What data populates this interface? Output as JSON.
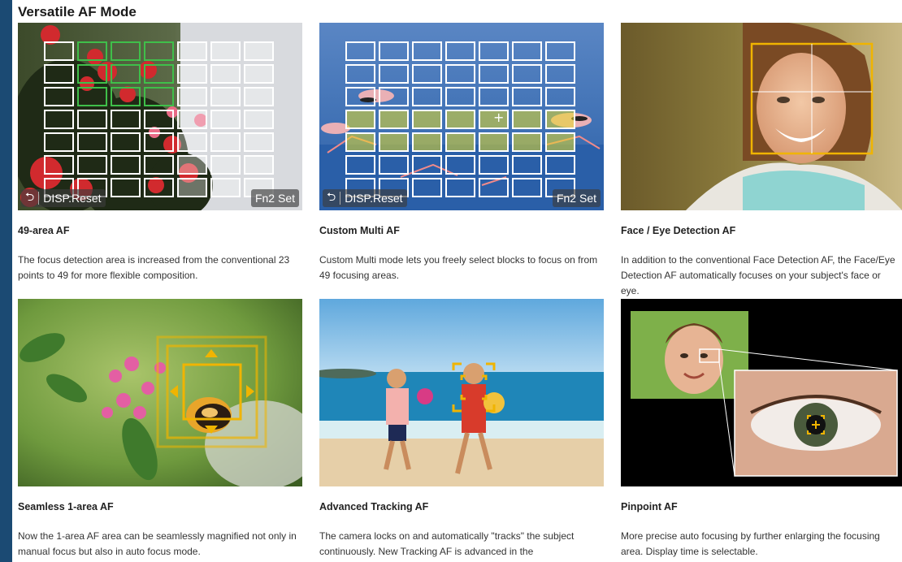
{
  "page": {
    "title": "Versatile AF Mode"
  },
  "colors": {
    "left_bar": "#1b4a73",
    "grid_line": "#ffffff",
    "grid_active": "#3fbf4a",
    "af_frame": "#f0b400"
  },
  "cards": [
    {
      "title": "49-area AF",
      "desc": "The focus detection area is increased from the conventional 23 points to 49 for more flexible composition.",
      "image": "flower-af-grid",
      "overlay": {
        "back_icon": "return-arrow-icon",
        "left_label": "DISP.Reset",
        "right_label": "Fn2 Set"
      }
    },
    {
      "title": "Custom Multi AF",
      "desc": "Custom Multi mode lets you freely select blocks to focus on from 49 focusing areas.",
      "image": "flamingo-af-grid",
      "overlay": {
        "back_icon": "return-arrow-icon",
        "left_label": "DISP.Reset",
        "right_label": "Fn2 Set"
      }
    },
    {
      "title": "Face / Eye Detection AF",
      "desc": "In addition to the conventional Face Detection AF, the Face/Eye Detection AF automatically focuses on your subject's face or eye.",
      "image": "smiling-woman-face-detection"
    },
    {
      "title": "Seamless 1-area AF",
      "desc": "Now the 1-area AF area can be seamlessly magnified not only in manual focus but also in auto focus mode.",
      "image": "butterfly-flower-1-area"
    },
    {
      "title": "Advanced Tracking AF",
      "desc": "The camera locks on and automatically \"tracks\" the subject continuously. New Tracking AF is advanced in the",
      "image": "beach-children-tracking"
    },
    {
      "title": "Pinpoint AF",
      "desc": "More precise auto focusing by further enlarging the focusing area. Display time is selectable.",
      "image": "girl-eye-pinpoint"
    }
  ]
}
